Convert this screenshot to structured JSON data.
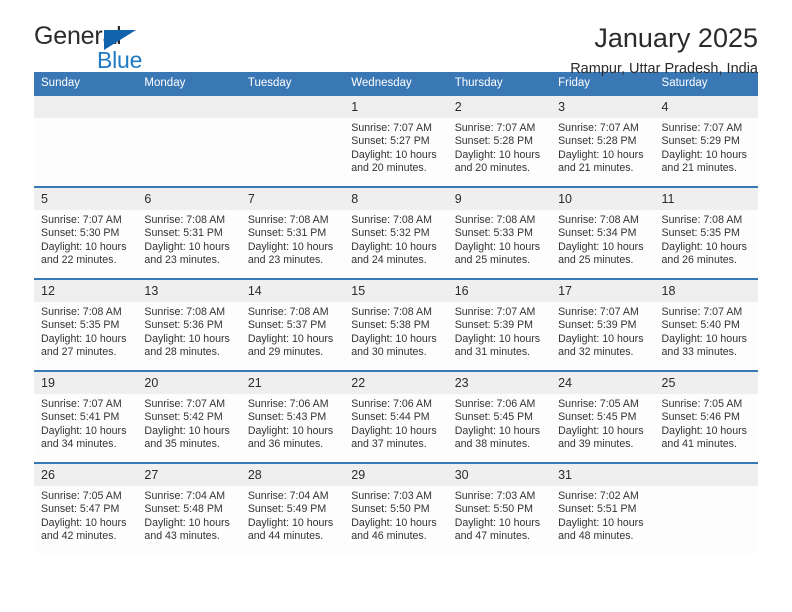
{
  "brand": {
    "name_top": "General",
    "name_bottom": "Blue",
    "accent_color": "#1f7ac4",
    "triangle_color": "#1263ad"
  },
  "header": {
    "title": "January 2025",
    "subtitle": "Rampur, Uttar Pradesh, India"
  },
  "theme": {
    "header_row_bg": "#3a78b5",
    "daynum_bg": "#efefef",
    "cell_bg": "#fdfdfd",
    "text": "#2b2b2b"
  },
  "weekdays": [
    "Sunday",
    "Monday",
    "Tuesday",
    "Wednesday",
    "Thursday",
    "Friday",
    "Saturday"
  ],
  "weeks": [
    [
      {
        "day": "",
        "sunrise": "",
        "sunset": "",
        "daylight": ""
      },
      {
        "day": "",
        "sunrise": "",
        "sunset": "",
        "daylight": ""
      },
      {
        "day": "",
        "sunrise": "",
        "sunset": "",
        "daylight": ""
      },
      {
        "day": "1",
        "sunrise": "Sunrise: 7:07 AM",
        "sunset": "Sunset: 5:27 PM",
        "daylight": "Daylight: 10 hours and 20 minutes."
      },
      {
        "day": "2",
        "sunrise": "Sunrise: 7:07 AM",
        "sunset": "Sunset: 5:28 PM",
        "daylight": "Daylight: 10 hours and 20 minutes."
      },
      {
        "day": "3",
        "sunrise": "Sunrise: 7:07 AM",
        "sunset": "Sunset: 5:28 PM",
        "daylight": "Daylight: 10 hours and 21 minutes."
      },
      {
        "day": "4",
        "sunrise": "Sunrise: 7:07 AM",
        "sunset": "Sunset: 5:29 PM",
        "daylight": "Daylight: 10 hours and 21 minutes."
      }
    ],
    [
      {
        "day": "5",
        "sunrise": "Sunrise: 7:07 AM",
        "sunset": "Sunset: 5:30 PM",
        "daylight": "Daylight: 10 hours and 22 minutes."
      },
      {
        "day": "6",
        "sunrise": "Sunrise: 7:08 AM",
        "sunset": "Sunset: 5:31 PM",
        "daylight": "Daylight: 10 hours and 23 minutes."
      },
      {
        "day": "7",
        "sunrise": "Sunrise: 7:08 AM",
        "sunset": "Sunset: 5:31 PM",
        "daylight": "Daylight: 10 hours and 23 minutes."
      },
      {
        "day": "8",
        "sunrise": "Sunrise: 7:08 AM",
        "sunset": "Sunset: 5:32 PM",
        "daylight": "Daylight: 10 hours and 24 minutes."
      },
      {
        "day": "9",
        "sunrise": "Sunrise: 7:08 AM",
        "sunset": "Sunset: 5:33 PM",
        "daylight": "Daylight: 10 hours and 25 minutes."
      },
      {
        "day": "10",
        "sunrise": "Sunrise: 7:08 AM",
        "sunset": "Sunset: 5:34 PM",
        "daylight": "Daylight: 10 hours and 25 minutes."
      },
      {
        "day": "11",
        "sunrise": "Sunrise: 7:08 AM",
        "sunset": "Sunset: 5:35 PM",
        "daylight": "Daylight: 10 hours and 26 minutes."
      }
    ],
    [
      {
        "day": "12",
        "sunrise": "Sunrise: 7:08 AM",
        "sunset": "Sunset: 5:35 PM",
        "daylight": "Daylight: 10 hours and 27 minutes."
      },
      {
        "day": "13",
        "sunrise": "Sunrise: 7:08 AM",
        "sunset": "Sunset: 5:36 PM",
        "daylight": "Daylight: 10 hours and 28 minutes."
      },
      {
        "day": "14",
        "sunrise": "Sunrise: 7:08 AM",
        "sunset": "Sunset: 5:37 PM",
        "daylight": "Daylight: 10 hours and 29 minutes."
      },
      {
        "day": "15",
        "sunrise": "Sunrise: 7:08 AM",
        "sunset": "Sunset: 5:38 PM",
        "daylight": "Daylight: 10 hours and 30 minutes."
      },
      {
        "day": "16",
        "sunrise": "Sunrise: 7:07 AM",
        "sunset": "Sunset: 5:39 PM",
        "daylight": "Daylight: 10 hours and 31 minutes."
      },
      {
        "day": "17",
        "sunrise": "Sunrise: 7:07 AM",
        "sunset": "Sunset: 5:39 PM",
        "daylight": "Daylight: 10 hours and 32 minutes."
      },
      {
        "day": "18",
        "sunrise": "Sunrise: 7:07 AM",
        "sunset": "Sunset: 5:40 PM",
        "daylight": "Daylight: 10 hours and 33 minutes."
      }
    ],
    [
      {
        "day": "19",
        "sunrise": "Sunrise: 7:07 AM",
        "sunset": "Sunset: 5:41 PM",
        "daylight": "Daylight: 10 hours and 34 minutes."
      },
      {
        "day": "20",
        "sunrise": "Sunrise: 7:07 AM",
        "sunset": "Sunset: 5:42 PM",
        "daylight": "Daylight: 10 hours and 35 minutes."
      },
      {
        "day": "21",
        "sunrise": "Sunrise: 7:06 AM",
        "sunset": "Sunset: 5:43 PM",
        "daylight": "Daylight: 10 hours and 36 minutes."
      },
      {
        "day": "22",
        "sunrise": "Sunrise: 7:06 AM",
        "sunset": "Sunset: 5:44 PM",
        "daylight": "Daylight: 10 hours and 37 minutes."
      },
      {
        "day": "23",
        "sunrise": "Sunrise: 7:06 AM",
        "sunset": "Sunset: 5:45 PM",
        "daylight": "Daylight: 10 hours and 38 minutes."
      },
      {
        "day": "24",
        "sunrise": "Sunrise: 7:05 AM",
        "sunset": "Sunset: 5:45 PM",
        "daylight": "Daylight: 10 hours and 39 minutes."
      },
      {
        "day": "25",
        "sunrise": "Sunrise: 7:05 AM",
        "sunset": "Sunset: 5:46 PM",
        "daylight": "Daylight: 10 hours and 41 minutes."
      }
    ],
    [
      {
        "day": "26",
        "sunrise": "Sunrise: 7:05 AM",
        "sunset": "Sunset: 5:47 PM",
        "daylight": "Daylight: 10 hours and 42 minutes."
      },
      {
        "day": "27",
        "sunrise": "Sunrise: 7:04 AM",
        "sunset": "Sunset: 5:48 PM",
        "daylight": "Daylight: 10 hours and 43 minutes."
      },
      {
        "day": "28",
        "sunrise": "Sunrise: 7:04 AM",
        "sunset": "Sunset: 5:49 PM",
        "daylight": "Daylight: 10 hours and 44 minutes."
      },
      {
        "day": "29",
        "sunrise": "Sunrise: 7:03 AM",
        "sunset": "Sunset: 5:50 PM",
        "daylight": "Daylight: 10 hours and 46 minutes."
      },
      {
        "day": "30",
        "sunrise": "Sunrise: 7:03 AM",
        "sunset": "Sunset: 5:50 PM",
        "daylight": "Daylight: 10 hours and 47 minutes."
      },
      {
        "day": "31",
        "sunrise": "Sunrise: 7:02 AM",
        "sunset": "Sunset: 5:51 PM",
        "daylight": "Daylight: 10 hours and 48 minutes."
      },
      {
        "day": "",
        "sunrise": "",
        "sunset": "",
        "daylight": ""
      }
    ]
  ]
}
